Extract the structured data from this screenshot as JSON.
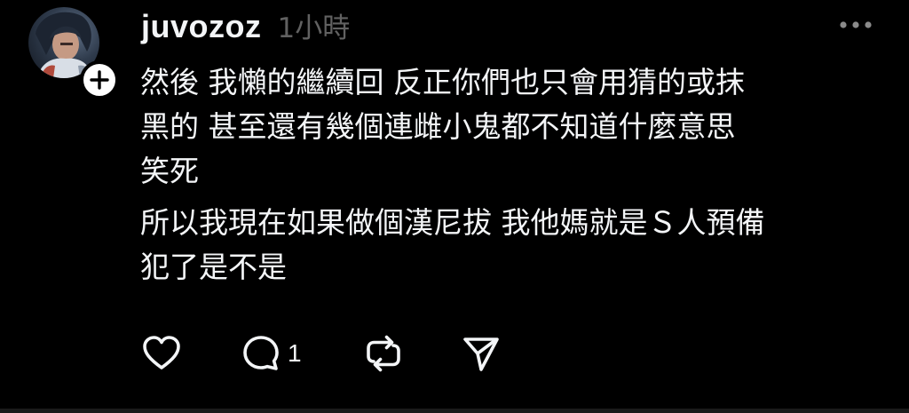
{
  "post": {
    "username": "juvozoz",
    "timestamp": "1小時",
    "paragraphs": [
      "然後 我懶的繼續回 反正你們也只會用猜的或抹\n黑的 甚至還有幾個連雌小鬼都不知道什麼意思\n笑死",
      "所以我現在如果做個漢尼拔 我他媽就是Ｓ人預備\n犯了是不是"
    ],
    "reply_count": "1"
  },
  "icons": {
    "avatar": "anime-character-avatar",
    "follow": "plus-icon",
    "more": "more-horizontal-icon",
    "like": "heart-icon",
    "reply": "comment-icon",
    "repost": "repost-icon",
    "share": "send-icon"
  },
  "colors": {
    "background": "#000000",
    "text": "#f3f5f7",
    "muted": "#616161"
  }
}
